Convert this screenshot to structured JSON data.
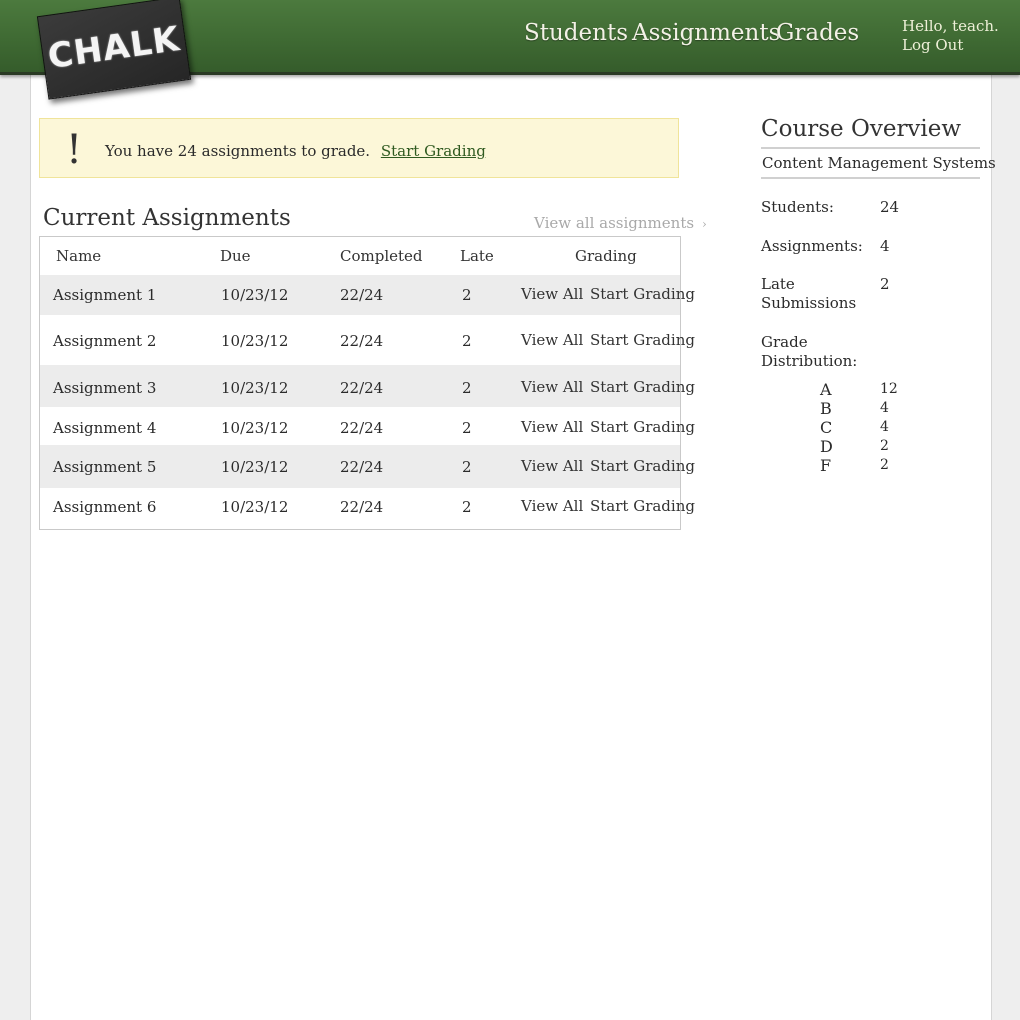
{
  "header": {
    "logo_text": "CHALK",
    "nav": [
      "Students",
      "Assignments",
      "Grades"
    ],
    "greeting": "Hello, teach.",
    "logout": "Log Out"
  },
  "alert": {
    "icon": "!",
    "message": "You have 24 assignments to grade.",
    "link": "Start Grading"
  },
  "assignments": {
    "title": "Current Assignments",
    "view_all": "View all assignments",
    "view_all_icon": "›",
    "columns": [
      "Name",
      "Due",
      "Completed",
      "Late",
      "Grading"
    ],
    "rows": [
      {
        "name": "Assignment 1",
        "due": "10/23/12",
        "completed": "22/24",
        "late": "2",
        "view": "View All",
        "grade": "Start Grading"
      },
      {
        "name": "Assignment 2",
        "due": "10/23/12",
        "completed": "22/24",
        "late": "2",
        "view": "View All",
        "grade": "Start Grading"
      },
      {
        "name": "Assignment 3",
        "due": "10/23/12",
        "completed": "22/24",
        "late": "2",
        "view": "View All",
        "grade": "Start Grading"
      },
      {
        "name": "Assignment 4",
        "due": "10/23/12",
        "completed": "22/24",
        "late": "2",
        "view": "View All",
        "grade": "Start Grading"
      },
      {
        "name": "Assignment 5",
        "due": "10/23/12",
        "completed": "22/24",
        "late": "2",
        "view": "View All",
        "grade": "Start Grading"
      },
      {
        "name": "Assignment 6",
        "due": "10/23/12",
        "completed": "22/24",
        "late": "2",
        "view": "View All",
        "grade": "Start Grading"
      }
    ]
  },
  "overview": {
    "title": "Course Overview",
    "course": "Content Management Systems",
    "stats": [
      {
        "label": "Students:",
        "value": "24"
      },
      {
        "label": "Assignments:",
        "value": "4"
      },
      {
        "label": "Late Submissions",
        "value": "2"
      },
      {
        "label": "Grade Distribution:",
        "value": ""
      }
    ],
    "grades": [
      {
        "letter": "A",
        "count": "12"
      },
      {
        "letter": "B",
        "count": "4"
      },
      {
        "letter": "C",
        "count": "4"
      },
      {
        "letter": "D",
        "count": "2"
      },
      {
        "letter": "F",
        "count": "2"
      }
    ]
  },
  "colors": {
    "header_green": "#3f6a33",
    "alert_bg": "#fcf7d8",
    "link_green": "#2f5a20",
    "row_alt": "#ececec"
  }
}
